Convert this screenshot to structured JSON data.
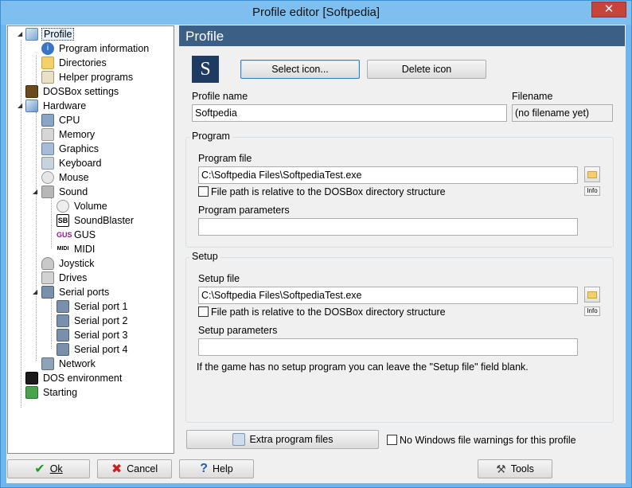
{
  "window": {
    "title": "Profile editor [Softpedia]",
    "close_glyph": "✕"
  },
  "tree": {
    "items": [
      {
        "label": "Profile",
        "icon": "profile-icon"
      },
      {
        "label": "Program information",
        "icon": "info-icon"
      },
      {
        "label": "Directories",
        "icon": "folder-icon"
      },
      {
        "label": "Helper programs",
        "icon": "helper-icon"
      },
      {
        "label": "DOSBox settings",
        "icon": "dosbox-icon"
      },
      {
        "label": "Hardware",
        "icon": "hardware-icon"
      },
      {
        "label": "CPU",
        "icon": "cpu-icon"
      },
      {
        "label": "Memory",
        "icon": "memory-icon"
      },
      {
        "label": "Graphics",
        "icon": "graphics-icon"
      },
      {
        "label": "Keyboard",
        "icon": "keyboard-icon"
      },
      {
        "label": "Mouse",
        "icon": "mouse-icon"
      },
      {
        "label": "Sound",
        "icon": "sound-icon"
      },
      {
        "label": "Volume",
        "icon": "volume-icon"
      },
      {
        "label": "SoundBlaster",
        "icon": "soundblaster-icon",
        "badge": "SB"
      },
      {
        "label": "GUS",
        "icon": "gus-icon",
        "badge": "GUS"
      },
      {
        "label": "MIDI",
        "icon": "midi-icon",
        "badge": "MIDI"
      },
      {
        "label": "Joystick",
        "icon": "joystick-icon"
      },
      {
        "label": "Drives",
        "icon": "drives-icon"
      },
      {
        "label": "Serial ports",
        "icon": "serial-ports-icon"
      },
      {
        "label": "Serial port 1",
        "icon": "serial-port-icon"
      },
      {
        "label": "Serial port 2",
        "icon": "serial-port-icon"
      },
      {
        "label": "Serial port 3",
        "icon": "serial-port-icon"
      },
      {
        "label": "Serial port 4",
        "icon": "serial-port-icon"
      },
      {
        "label": "Network",
        "icon": "network-icon"
      },
      {
        "label": "DOS environment",
        "icon": "dos-environment-icon"
      },
      {
        "label": "Starting",
        "icon": "starting-icon"
      }
    ]
  },
  "panel": {
    "header": "Profile",
    "icon_letter": "S",
    "select_icon_label": "Select icon...",
    "delete_icon_label": "Delete icon",
    "profile_name_label": "Profile name",
    "profile_name_value": "Softpedia",
    "filename_label": "Filename",
    "filename_value": "(no filename yet)",
    "program": {
      "group_title": "Program",
      "file_label": "Program file",
      "file_value": "C:\\Softpedia Files\\SoftpediaTest.exe",
      "relative_label": "File path is relative to the DOSBox directory structure",
      "info_label": "Info",
      "params_label": "Program parameters",
      "params_value": ""
    },
    "setup": {
      "group_title": "Setup",
      "file_label": "Setup file",
      "file_value": "C:\\Softpedia Files\\SoftpediaTest.exe",
      "relative_label": "File path is relative to the DOSBox directory structure",
      "info_label": "Info",
      "params_label": "Setup parameters",
      "params_value": "",
      "hint": "If the game has no setup program you can leave the \"Setup file\" field blank."
    },
    "extra_files_label": "Extra program files",
    "no_warnings_label": "No Windows file warnings for this profile"
  },
  "footer": {
    "ok_label": "Ok",
    "cancel_label": "Cancel",
    "help_label": "Help",
    "tools_label": "Tools"
  },
  "colors": {
    "header_bg": "#3c5f85",
    "title_bar": "#7ebff0",
    "close": "#c7443a"
  }
}
